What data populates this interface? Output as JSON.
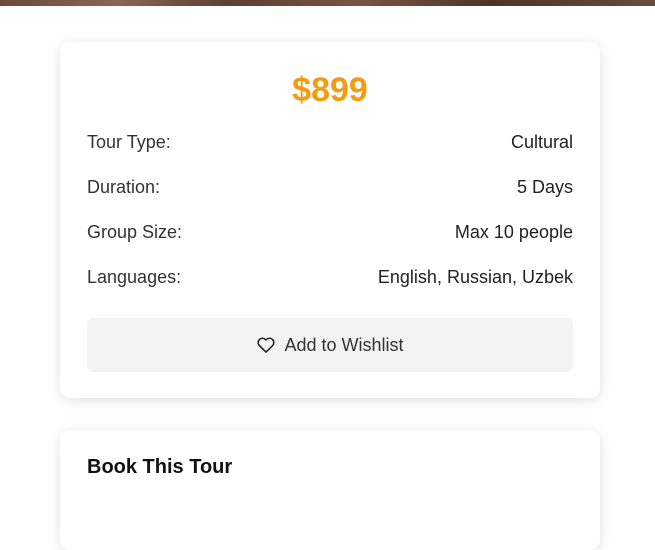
{
  "pricing": {
    "price": "$899",
    "details": [
      {
        "label": "Tour Type:",
        "value": "Cultural"
      },
      {
        "label": "Duration:",
        "value": "5 Days"
      },
      {
        "label": "Group Size:",
        "value": "Max 10 people"
      },
      {
        "label": "Languages:",
        "value": "English, Russian, Uzbek"
      }
    ],
    "wishlist_label": "Add to Wishlist",
    "wishlist_icon": "heart-icon"
  },
  "booking": {
    "title": "Book This Tour"
  },
  "colors": {
    "price": "#f39c12",
    "button_bg": "#f3f3f3"
  }
}
